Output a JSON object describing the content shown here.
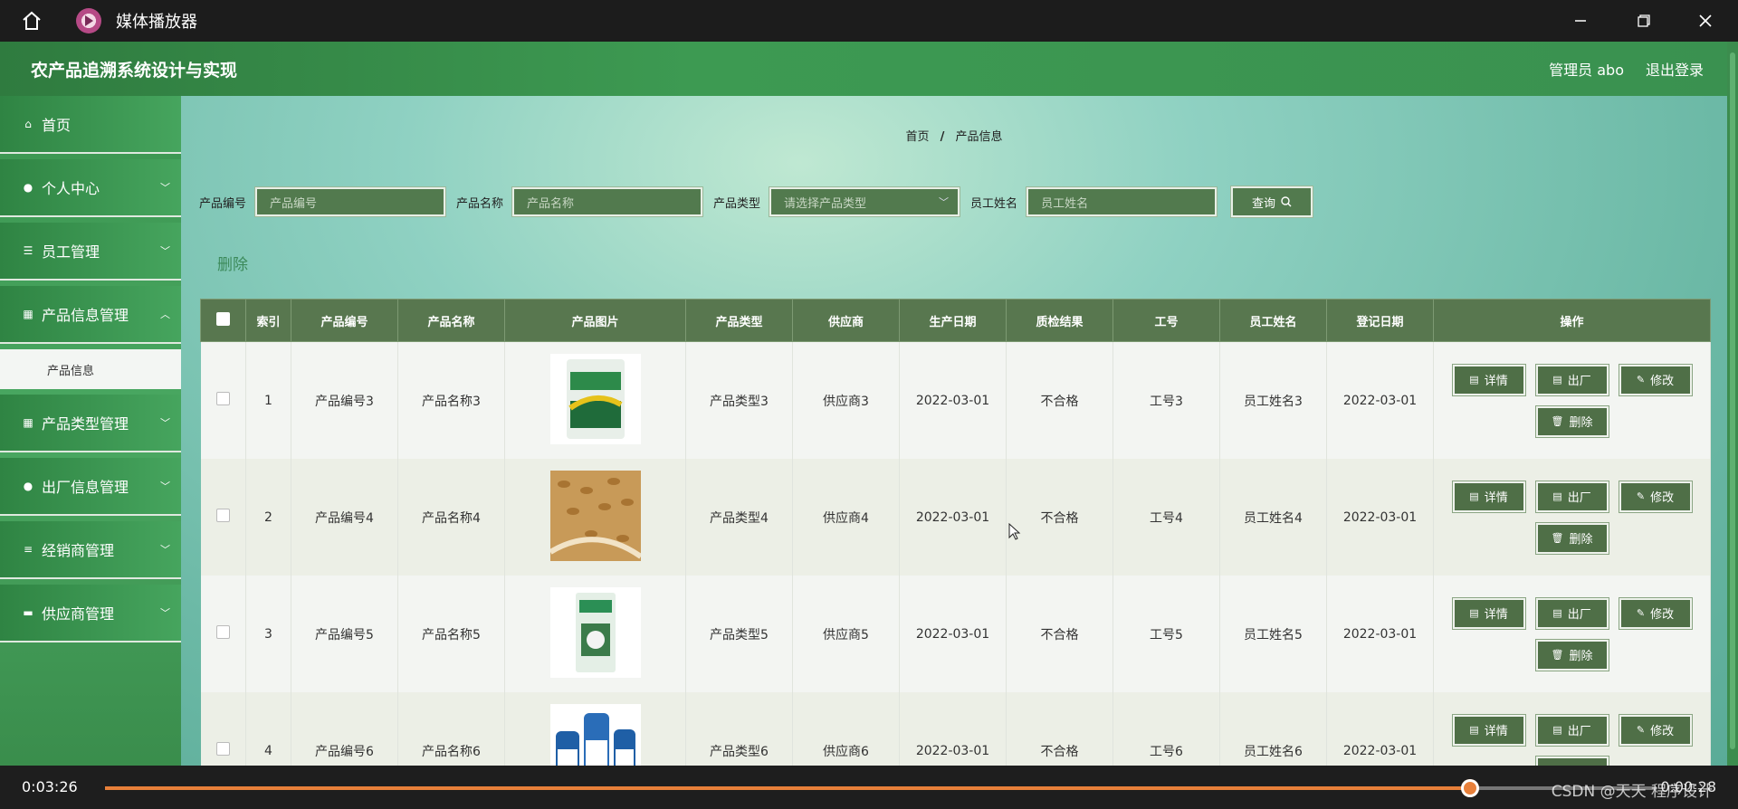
{
  "player": {
    "title": "媒体播放器"
  },
  "app": {
    "system_title": "农产品追溯系统设计与实现",
    "admin_label": "管理员 abo",
    "logout": "退出登录"
  },
  "sidebar": {
    "items": [
      {
        "label": "首页",
        "icon": "home-icon",
        "chevron": false
      },
      {
        "label": "个人中心",
        "icon": "user-icon",
        "chevron": true
      },
      {
        "label": "员工管理",
        "icon": "sliders-icon",
        "chevron": true
      },
      {
        "label": "产品信息管理",
        "icon": "grid-icon",
        "chevron": true,
        "sub": "产品信息"
      },
      {
        "label": "产品类型管理",
        "icon": "grid-icon",
        "chevron": true
      },
      {
        "label": "出厂信息管理",
        "icon": "pin-icon",
        "chevron": true
      },
      {
        "label": "经销商管理",
        "icon": "list-icon",
        "chevron": true
      },
      {
        "label": "供应商管理",
        "icon": "box-icon",
        "chevron": true
      }
    ]
  },
  "breadcrumb": {
    "home": "首页",
    "sep": "/",
    "current": "产品信息"
  },
  "search": {
    "code_label": "产品编号",
    "code_placeholder": "产品编号",
    "name_label": "产品名称",
    "name_placeholder": "产品名称",
    "type_label": "产品类型",
    "type_placeholder": "请选择产品类型",
    "staff_label": "员工姓名",
    "staff_placeholder": "员工姓名",
    "query": "查询"
  },
  "actions": {
    "delete": "删除"
  },
  "table": {
    "headers": [
      "索引",
      "产品编号",
      "产品名称",
      "产品图片",
      "产品类型",
      "供应商",
      "生产日期",
      "质检结果",
      "工号",
      "员工姓名",
      "登记日期",
      "操作"
    ],
    "ops": {
      "detail": "详情",
      "ship": "出厂",
      "edit": "修改",
      "delete": "删除"
    },
    "rows": [
      {
        "index": "1",
        "code": "产品编号3",
        "name": "产品名称3",
        "type": "产品类型3",
        "supplier": "供应商3",
        "prod_date": "2022-03-01",
        "qc": "不合格",
        "emp_no": "工号3",
        "emp_name": "员工姓名3",
        "reg_date": "2022-03-01"
      },
      {
        "index": "2",
        "code": "产品编号4",
        "name": "产品名称4",
        "type": "产品类型4",
        "supplier": "供应商4",
        "prod_date": "2022-03-01",
        "qc": "不合格",
        "emp_no": "工号4",
        "emp_name": "员工姓名4",
        "reg_date": "2022-03-01"
      },
      {
        "index": "3",
        "code": "产品编号5",
        "name": "产品名称5",
        "type": "产品类型5",
        "supplier": "供应商5",
        "prod_date": "2022-03-01",
        "qc": "不合格",
        "emp_no": "工号5",
        "emp_name": "员工姓名5",
        "reg_date": "2022-03-01"
      },
      {
        "index": "4",
        "code": "产品编号6",
        "name": "产品名称6",
        "type": "产品类型6",
        "supplier": "供应商6",
        "prod_date": "2022-03-01",
        "qc": "不合格",
        "emp_no": "工号6",
        "emp_name": "员工姓名6",
        "reg_date": "2022-03-01"
      }
    ]
  },
  "video": {
    "elapsed": "0:03:26",
    "remaining": "0:00:28",
    "progress": 0.88,
    "watermark": "CSDN @天天 程序设计"
  },
  "colors": {
    "header_green": "#3d9a52",
    "table_header": "#58774f",
    "button": "#4f6f47",
    "progress": "#e8803a"
  }
}
